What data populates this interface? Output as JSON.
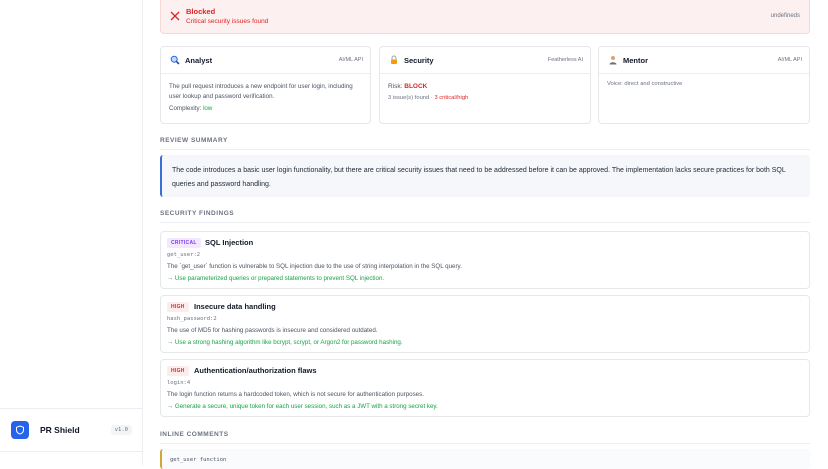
{
  "banner": {
    "title": "Blocked",
    "subtitle": "Critical security issues found",
    "right": "undefineds"
  },
  "agents": [
    {
      "name": "Analyst",
      "provider": "AI/ML API",
      "icon": "magnifier-icon",
      "body": "The pull request introduces a new endpoint for user login, including user lookup and password verification.",
      "complexity_label": "Complexity:",
      "complexity_value": "low"
    },
    {
      "name": "Security",
      "provider": "Featherless AI",
      "icon": "lock-icon",
      "risk_label": "Risk:",
      "risk_value": "BLOCK",
      "issues_found": "3 issue(s) found",
      "separator": "·",
      "critical": "3 critical/high"
    },
    {
      "name": "Mentor",
      "provider": "AI/ML API",
      "icon": "person-icon",
      "voice": "Voice: direct and constructive"
    }
  ],
  "review_summary": {
    "label": "REVIEW SUMMARY",
    "text": "The code introduces a basic user login functionality, but there are critical security issues that need to be addressed before it can be approved. The implementation lacks secure practices for both SQL queries and password handling."
  },
  "security_findings": {
    "label": "SECURITY FINDINGS",
    "items": [
      {
        "severity": "CRITICAL",
        "title": "SQL Injection",
        "location": "get_user:2",
        "description": "The `get_user` function is vulnerable to SQL injection due to the use of string interpolation in the SQL query.",
        "fix": "→ Use parameterized queries or prepared statements to prevent SQL injection."
      },
      {
        "severity": "HIGH",
        "title": "Insecure data handling",
        "location": "hash_password:2",
        "description": "The use of MD5 for hashing passwords is insecure and considered outdated.",
        "fix": "→ Use a strong hashing algorithm like bcrypt, scrypt, or Argon2 for password hashing."
      },
      {
        "severity": "HIGH",
        "title": "Authentication/authorization flaws",
        "location": "login:4",
        "description": "The login function returns a hardcoded token, which is not secure for authentication purposes.",
        "fix": "→ Generate a secure, unique token for each user session, such as a JWT with a strong secret key."
      }
    ]
  },
  "inline_comments": {
    "label": "INLINE COMMENTS",
    "first": "get_user function"
  },
  "brand": {
    "name": "PR Shield",
    "version": "v1.0"
  },
  "colors": {
    "accent": "#2563eb",
    "danger": "#dc2626",
    "success": "#16a34a",
    "critical": "#7c3aed"
  }
}
